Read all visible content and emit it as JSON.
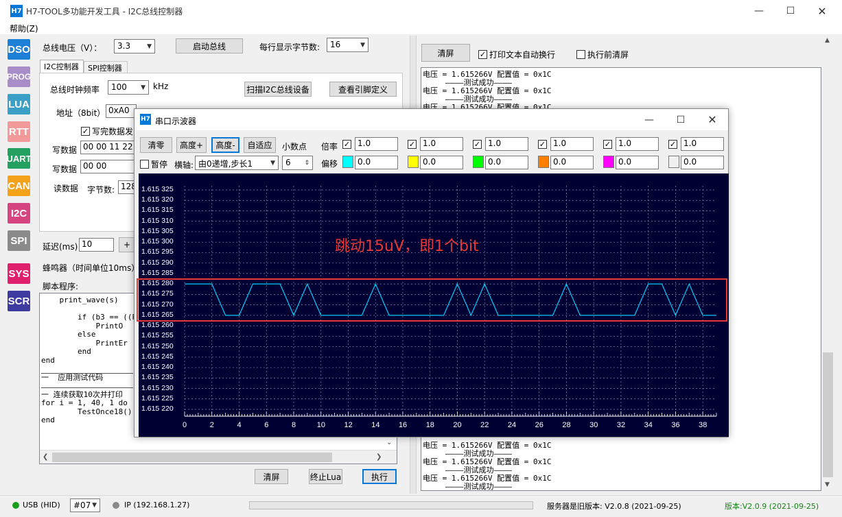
{
  "window": {
    "title": "H7-TOOL多功能开发工具 - I2C总线控制器",
    "icon": "H7"
  },
  "menu": {
    "help": "帮助(Z)"
  },
  "sidebar": [
    "DSO",
    "PROG",
    "LUA",
    "RTT",
    "UART",
    "CAN",
    "I2C",
    "SPI",
    "SYS",
    "SCR"
  ],
  "left": {
    "voltage_label": "总线电压（V）：",
    "voltage_value": "3.3",
    "start_bus": "启动总线",
    "bytes_per_row_label": "每行显示字节数:",
    "bytes_per_row_value": "16",
    "tab_i2c": "I2C控制器",
    "tab_spi": "SPI控制器",
    "clock_label": "总线时钟频率",
    "clock_value": "100",
    "clock_unit": "kHz",
    "scan_btn": "扫描I2C总线设备",
    "pins_btn": "查看引脚定义",
    "addr_label": "地址（8bit）",
    "addr_value": "0xA0",
    "write_after_label": "写完数据发",
    "write_data_label": "写数据",
    "write_data_value": "00 00 11 22",
    "write_data2_label": "写数据",
    "write_data2_value": "00 00",
    "read_data_label": "读数据",
    "bytes_label": "字节数:",
    "bytes_value": "128",
    "delay_label": "延迟(ms)",
    "delay_value": "10",
    "plus_btn": "+",
    "beeper_label": "蜂鸣器（时间单位10ms）",
    "script_label": "脚本程序:",
    "code_lines": [
      "    print_wave(s)",
      "",
      "        if (b3 == ((Pe",
      "            PrintO",
      "        else",
      "            PrintEr",
      "        end",
      "end",
      "",
      "一  应用测试代码",
      "",
      "一 连续获取10次并打印",
      "for i = 1, 40, 1 do",
      "        TestOnce18()",
      "end"
    ],
    "clear_btn": "清屏",
    "stop_lua_btn": "终止Lua",
    "run_btn": "执行"
  },
  "right": {
    "clear_btn": "清屏",
    "wrap_label": "打印文本自动换行",
    "clear_before_label": "执行前清屏",
    "log_top": [
      "电压 = 1.615266V 配置值 = 0x1C",
      "————测试成功————",
      "电压 = 1.615266V 配置值 = 0x1C",
      "————测试成功————",
      "电压 = 1.615266V 配置值 = 0x1C"
    ],
    "log_bottom": [
      "电压 = 1.615266V 配置值 = 0x1C",
      "————测试成功————",
      "电压 = 1.615266V 配置值 = 0x1C",
      "————测试成功————",
      "电压 = 1.615266V 配置值 = 0x1C",
      "————测试成功————"
    ]
  },
  "scope": {
    "title": "串口示波器",
    "icon": "H7",
    "clear": "清零",
    "height_plus": "高度+",
    "height_minus": "高度-",
    "auto": "自适应",
    "decimals_label": "小数点",
    "decimals_value": "6",
    "pause": "暂停",
    "xaxis_label": "横轴:",
    "xaxis_value": "由0递增,步长1",
    "scale_label": "倍率",
    "offset_label": "偏移",
    "channels": [
      {
        "scale": "1.0",
        "offset": "0.0",
        "color": "#00ffff"
      },
      {
        "scale": "1.0",
        "offset": "0.0",
        "color": "#ffff00"
      },
      {
        "scale": "1.0",
        "offset": "0.0",
        "color": "#00ff00"
      },
      {
        "scale": "1.0",
        "offset": "0.0",
        "color": "#ff8000"
      },
      {
        "scale": "1.0",
        "offset": "0.0",
        "color": "#ff00ff"
      },
      {
        "scale": "1.0",
        "offset": "0.0",
        "color": "#f0f0f0"
      }
    ],
    "annotation": "跳动15uV，即1个bit"
  },
  "chart_data": {
    "type": "line",
    "title": "",
    "xlabel": "",
    "ylabel": "",
    "ylim": [
      1.61522,
      1.615325
    ],
    "xlim": [
      0,
      39
    ],
    "yticks": [
      "1.615 325",
      "1.615 320",
      "1.615 315",
      "1.615 310",
      "1.615 305",
      "1.615 300",
      "1.615 295",
      "1.615 290",
      "1.615 285",
      "1.615 280",
      "1.615 275",
      "1.615 270",
      "1.615 265",
      "1.615 260",
      "1.615 255",
      "1.615 250",
      "1.615 245",
      "1.615 240",
      "1.615 235",
      "1.615 230",
      "1.615 225",
      "1.615 220"
    ],
    "xticks": [
      0,
      2,
      4,
      6,
      8,
      10,
      12,
      14,
      16,
      18,
      20,
      22,
      24,
      26,
      28,
      30,
      32,
      34,
      36,
      38
    ],
    "series": [
      {
        "color": "#00ccff",
        "x": [
          0,
          1,
          2,
          3,
          4,
          5,
          6,
          7,
          8,
          9,
          10,
          11,
          12,
          13,
          14,
          15,
          16,
          17,
          18,
          19,
          20,
          21,
          22,
          23,
          24,
          25,
          26,
          27,
          28,
          29,
          30,
          31,
          32,
          33,
          34,
          35,
          36,
          37,
          38,
          39
        ],
        "values": [
          1.61528,
          1.61528,
          1.61528,
          1.615265,
          1.615265,
          1.61528,
          1.61528,
          1.61528,
          1.615265,
          1.61528,
          1.615265,
          1.615265,
          1.615265,
          1.615265,
          1.61528,
          1.615265,
          1.615265,
          1.615265,
          1.615265,
          1.615265,
          1.61528,
          1.615265,
          1.61528,
          1.615265,
          1.615265,
          1.615265,
          1.615265,
          1.615265,
          1.61528,
          1.615265,
          1.615265,
          1.615265,
          1.615265,
          1.615265,
          1.61528,
          1.61528,
          1.615265,
          1.61528,
          1.615265,
          1.615265
        ]
      }
    ]
  },
  "status": {
    "usb": "USB (HID)",
    "port": "#07",
    "ip": "IP (192.168.1.27)",
    "server": "服务器是旧版本: V2.0.8 (2021-09-25)",
    "version": "版本:V2.0.9 (2021-09-25)"
  },
  "colors": {
    "accent": "#0078d7",
    "highlight": "#e53935",
    "plot_bg": "#000033",
    "trace": "#00ccff",
    "status_green": "#1a9e1a",
    "version_green": "#118811"
  }
}
